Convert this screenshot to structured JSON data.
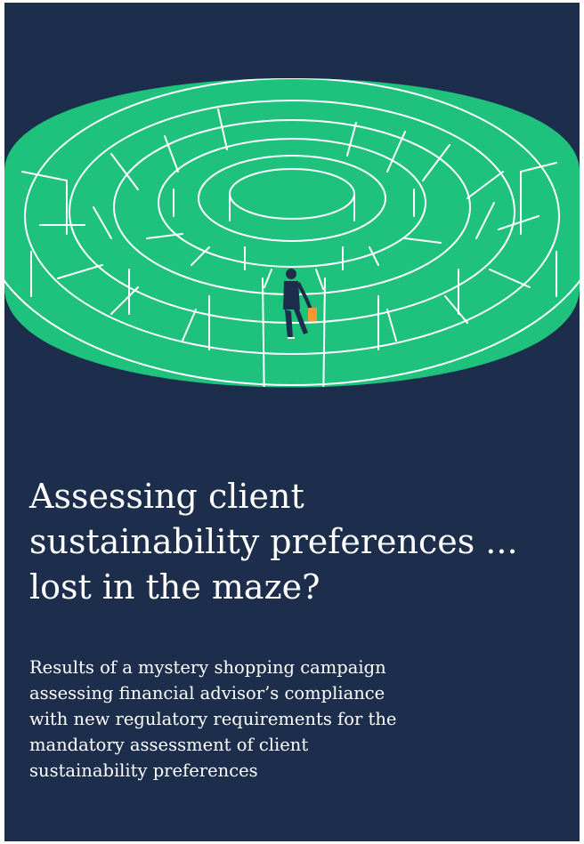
{
  "cover": {
    "title": "Assessing client\nsustainability preferences ...\nlost in the maze?",
    "subtitle": "Results of a mystery shopping campaign\nassessing financial advisor’s compliance\nwith new regulatory requirements for the\nmandatory assessment of client\nsustainability preferences"
  },
  "colors": {
    "background": "#1d2e4c",
    "maze_green": "#1fc27d",
    "maze_lines": "#ffffff",
    "figure_bag": "#f39a34"
  },
  "illustration": {
    "subject": "maze",
    "figure": "businessman-with-briefcase"
  }
}
